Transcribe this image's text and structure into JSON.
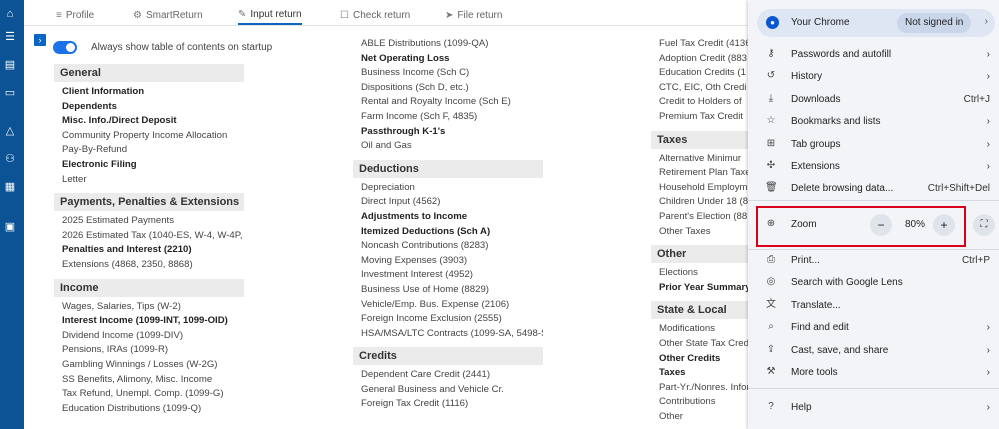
{
  "sidebar_icons": [
    "bank-icon",
    "list-icon",
    "clipboard-icon",
    "window-icon",
    "alert-icon",
    "people-icon",
    "grid-icon",
    "money-icon"
  ],
  "tabs": [
    {
      "label": "Profile",
      "icon": "≡"
    },
    {
      "label": "SmartReturn",
      "icon": "⚙"
    },
    {
      "label": "Input return",
      "icon": "✎"
    },
    {
      "label": "Check return",
      "icon": "☐"
    },
    {
      "label": "File return",
      "icon": "➤"
    }
  ],
  "toc_toggle": "›",
  "always_show_label": "Always show table of contents on startup",
  "col1": [
    {
      "title": "General",
      "items": [
        {
          "t": "Client Information",
          "b": true
        },
        {
          "t": "Dependents",
          "b": true
        },
        {
          "t": "Misc. Info./Direct Deposit",
          "b": true
        },
        {
          "t": "Community Property Income Allocation",
          "b": false
        },
        {
          "t": "Pay-By-Refund",
          "b": false
        },
        {
          "t": "Electronic Filing",
          "b": true
        },
        {
          "t": "Letter",
          "b": false
        }
      ]
    },
    {
      "title": "Payments, Penalties & Extensions",
      "items": [
        {
          "t": "2025 Estimated Payments",
          "b": false
        },
        {
          "t": "2026 Estimated Tax (1040-ES, W-4, W-4P, W-4R)",
          "b": false
        },
        {
          "t": "Penalties and Interest (2210)",
          "b": true
        },
        {
          "t": "Extensions (4868, 2350, 8868)",
          "b": false
        }
      ]
    },
    {
      "title": "Income",
      "items": [
        {
          "t": "Wages, Salaries, Tips (W-2)",
          "b": false
        },
        {
          "t": "Interest Income (1099-INT, 1099-OID)",
          "b": true
        },
        {
          "t": "Dividend Income (1099-DIV)",
          "b": false
        },
        {
          "t": "Pensions, IRAs (1099-R)",
          "b": false
        },
        {
          "t": "Gambling Winnings / Losses (W-2G)",
          "b": false
        },
        {
          "t": "SS Benefits, Alimony, Misc. Income",
          "b": false
        },
        {
          "t": "Tax Refund, Unempl. Comp. (1099-G)",
          "b": false
        },
        {
          "t": "Education Distributions (1099-Q)",
          "b": false
        }
      ]
    }
  ],
  "col2": [
    {
      "title": "",
      "items": [
        {
          "t": "ABLE Distributions (1099-QA)",
          "b": false
        },
        {
          "t": "Net Operating Loss",
          "b": true
        },
        {
          "t": "Business Income (Sch C)",
          "b": false
        },
        {
          "t": "Dispositions (Sch D, etc.)",
          "b": false
        },
        {
          "t": "Rental and Royalty Income (Sch E)",
          "b": false
        },
        {
          "t": "Farm Income (Sch F, 4835)",
          "b": false
        },
        {
          "t": "Passthrough K-1's",
          "b": true
        },
        {
          "t": "Oil and Gas",
          "b": false
        }
      ]
    },
    {
      "title": "Deductions",
      "items": [
        {
          "t": "Depreciation",
          "b": false
        },
        {
          "t": "Direct Input (4562)",
          "b": false
        },
        {
          "t": "Adjustments to Income",
          "b": true
        },
        {
          "t": "Itemized Deductions (Sch A)",
          "b": true
        },
        {
          "t": "Noncash Contributions (8283)",
          "b": false
        },
        {
          "t": "Moving Expenses (3903)",
          "b": false
        },
        {
          "t": "Investment Interest (4952)",
          "b": false
        },
        {
          "t": "Business Use of Home (8829)",
          "b": false
        },
        {
          "t": "Vehicle/Emp. Bus. Expense (2106)",
          "b": false
        },
        {
          "t": "Foreign Income Exclusion (2555)",
          "b": false
        },
        {
          "t": "HSA/MSA/LTC Contracts (1099-SA, 5498-SA)",
          "b": false
        }
      ]
    },
    {
      "title": "Credits",
      "items": [
        {
          "t": "Dependent Care Credit (2441)",
          "b": false
        },
        {
          "t": "General Business and Vehicle Cr.",
          "b": false
        },
        {
          "t": "Foreign Tax Credit (1116)",
          "b": false
        }
      ]
    }
  ],
  "col3": [
    {
      "title": "",
      "items": [
        {
          "t": "Fuel Tax Credit (4136",
          "b": false
        },
        {
          "t": "Adoption Credit (883",
          "b": false
        },
        {
          "t": "Education Credits (1",
          "b": false
        },
        {
          "t": "CTC, EIC, Oth Credi",
          "b": false
        },
        {
          "t": "Credit to Holders of",
          "b": false
        },
        {
          "t": "Premium Tax Credit",
          "b": false
        }
      ]
    },
    {
      "title": "Taxes",
      "items": [
        {
          "t": "Alternative Minimur",
          "b": false
        },
        {
          "t": "Retirement Plan Taxes",
          "b": false
        },
        {
          "t": "Household Employm",
          "b": false
        },
        {
          "t": "Children Under 18 (8",
          "b": false
        },
        {
          "t": "Parent's Election (881",
          "b": false
        },
        {
          "t": "Other Taxes",
          "b": false
        }
      ]
    },
    {
      "title": "Other",
      "items": [
        {
          "t": "Elections",
          "b": false
        },
        {
          "t": "Prior Year Summary",
          "b": true
        }
      ]
    },
    {
      "title": "State & Local",
      "items": [
        {
          "t": "Modifications",
          "b": false
        },
        {
          "t": "Other State Tax Credi",
          "b": false
        },
        {
          "t": "Other Credits",
          "b": true
        },
        {
          "t": "Taxes",
          "b": true
        },
        {
          "t": "Part-Yr./Nonres. Inforn",
          "b": false
        },
        {
          "t": "Contributions",
          "b": false
        },
        {
          "t": "Other",
          "b": false
        }
      ]
    }
  ],
  "chrome_menu": {
    "profile_label": "Your Chrome",
    "profile_status": "Not signed in",
    "items_a": [
      {
        "label": "Passwords and autofill",
        "icon": "⚷",
        "right": "›",
        "name": "passwords"
      },
      {
        "label": "History",
        "icon": "↺",
        "right": "›",
        "name": "history"
      },
      {
        "label": "Downloads",
        "icon": "⤓",
        "right": "Ctrl+J",
        "name": "downloads"
      },
      {
        "label": "Bookmarks and lists",
        "icon": "☆",
        "right": "›",
        "name": "bookmarks"
      },
      {
        "label": "Tab groups",
        "icon": "⊞",
        "right": "›",
        "name": "tab-groups"
      },
      {
        "label": "Extensions",
        "icon": "✣",
        "right": "›",
        "name": "extensions"
      },
      {
        "label": "Delete browsing data...",
        "icon": "🗑",
        "right": "Ctrl+Shift+Del",
        "name": "delete-data"
      }
    ],
    "zoom_label": "Zoom",
    "zoom_minus": "−",
    "zoom_value": "80%",
    "zoom_plus": "+",
    "items_b": [
      {
        "label": "Print...",
        "icon": "⎙",
        "right": "Ctrl+P",
        "name": "print"
      },
      {
        "label": "Search with Google Lens",
        "icon": "◎",
        "right": "",
        "name": "google-lens"
      },
      {
        "label": "Translate...",
        "icon": "文",
        "right": "",
        "name": "translate"
      },
      {
        "label": "Find and edit",
        "icon": "⌕",
        "right": "›",
        "name": "find-edit"
      },
      {
        "label": "Cast, save, and share",
        "icon": "⇪",
        "right": "›",
        "name": "cast-save-share"
      },
      {
        "label": "More tools",
        "icon": "⚒",
        "right": "›",
        "name": "more-tools"
      }
    ],
    "help_label": "Help",
    "help_icon": "?",
    "help_right": "›"
  }
}
